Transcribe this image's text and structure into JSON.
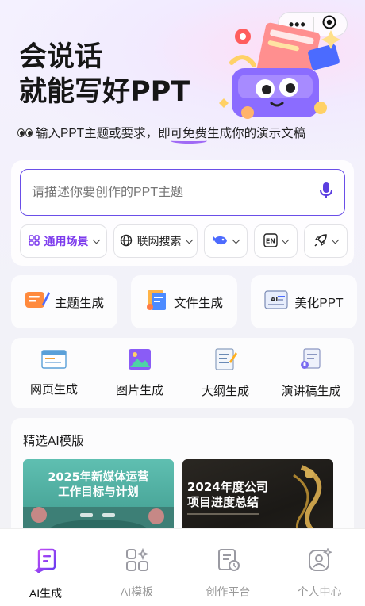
{
  "capsule": {
    "more_icon": "more-dots-icon",
    "close_icon": "target-icon"
  },
  "hero": {
    "title_line1": "会说话",
    "title_line2": "就能写好PPT",
    "subtitle_pre": "输入PPT主题或要求，即",
    "subtitle_highlight": "可免费",
    "subtitle_post": "生成你的演示文稿"
  },
  "input": {
    "placeholder": "请描述你要创作的PPT主题",
    "mic_icon": "microphone-icon"
  },
  "chips": {
    "scene_label": "通用场景",
    "web_label": "联网搜索",
    "model_icon": "whale-icon",
    "lang_icon": "en-language-icon",
    "rocket_icon": "rocket-icon"
  },
  "generators": [
    {
      "label": "主题生成",
      "icon": "topic-icon"
    },
    {
      "label": "文件生成",
      "icon": "file-icon"
    },
    {
      "label": "美化PPT",
      "icon": "beautify-icon"
    }
  ],
  "tools": [
    {
      "label": "网页生成",
      "icon": "webpage-icon"
    },
    {
      "label": "图片生成",
      "icon": "image-icon"
    },
    {
      "label": "大纲生成",
      "icon": "outline-icon"
    },
    {
      "label": "演讲稿生成",
      "icon": "speech-icon"
    }
  ],
  "templates": {
    "title": "精选AI模版",
    "items": [
      {
        "line1": "2025年新媒体运营",
        "line2": "工作目标与计划"
      },
      {
        "line1": "2024年度公司",
        "line2": "项目进度总结"
      }
    ]
  },
  "tabbar": [
    {
      "label": "AI生成",
      "active": true
    },
    {
      "label": "AI模板",
      "active": false
    },
    {
      "label": "创作平台",
      "active": false
    },
    {
      "label": "个人中心",
      "active": false
    }
  ],
  "colors": {
    "accent": "#7c3aed",
    "input_border": "#6a4ee8"
  }
}
